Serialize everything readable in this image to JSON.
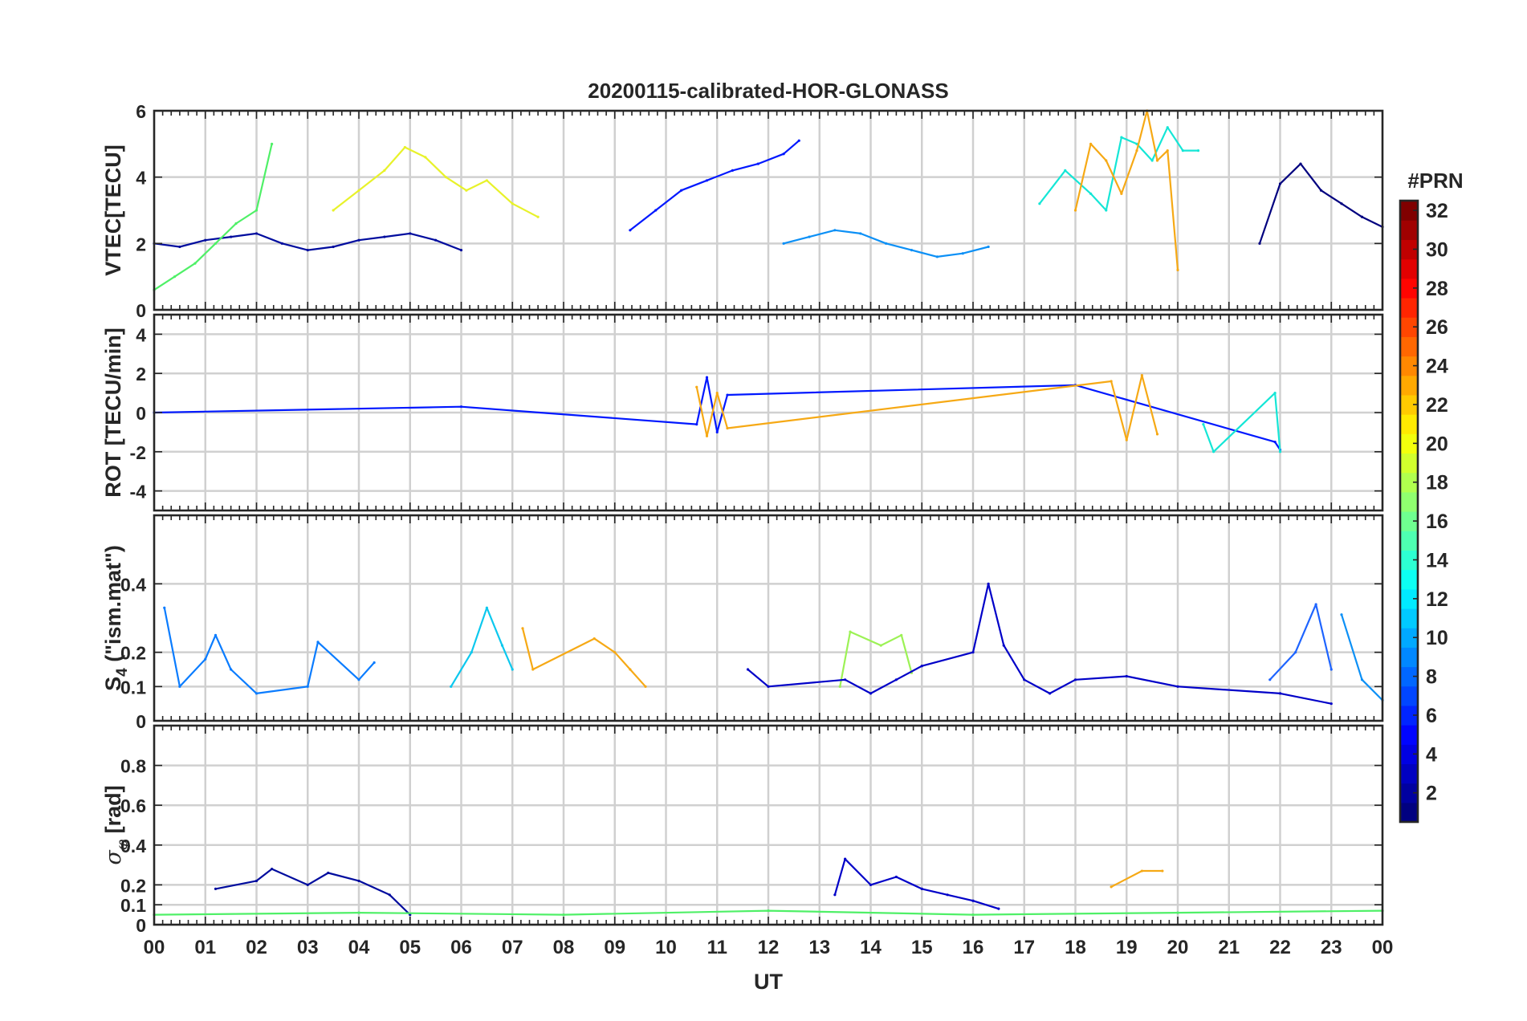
{
  "figure": {
    "title": "20200115-calibrated-HOR-GLONASS",
    "xlabel": "UT",
    "x_ticklabels": [
      "00",
      "01",
      "02",
      "03",
      "04",
      "05",
      "06",
      "07",
      "08",
      "09",
      "10",
      "11",
      "12",
      "13",
      "14",
      "15",
      "16",
      "17",
      "18",
      "19",
      "20",
      "21",
      "22",
      "23",
      "00"
    ]
  },
  "colorbar": {
    "label": "#PRN",
    "ticks": [
      "2",
      "4",
      "6",
      "8",
      "10",
      "12",
      "14",
      "16",
      "18",
      "20",
      "22",
      "24",
      "26",
      "28",
      "30",
      "32"
    ],
    "colormap": "jet",
    "range": [
      1,
      32
    ]
  },
  "chart_data": [
    {
      "type": "line",
      "id": "vtec",
      "ylabel": "VTEC[TECU]",
      "xlim": [
        0,
        24
      ],
      "ylim": [
        0,
        6
      ],
      "yticks": [
        "0",
        "2",
        "4",
        "6"
      ],
      "ytick_values": [
        0,
        2,
        4,
        6
      ],
      "grid": true,
      "colored_by": "PRN",
      "series": [
        {
          "prn": 2,
          "color": "#000c9e",
          "x": [
            0,
            0.5,
            1,
            1.5,
            2,
            2.5,
            3,
            3.5,
            4,
            4.5,
            5,
            5.5,
            6
          ],
          "y": [
            2.0,
            1.9,
            2.1,
            2.2,
            2.3,
            2.0,
            1.8,
            1.9,
            2.1,
            2.2,
            2.3,
            2.1,
            1.8
          ]
        },
        {
          "prn": 4,
          "color": "#0018ff",
          "x": [
            9.3,
            9.8,
            10.3,
            10.8,
            11.3,
            11.8,
            12.3,
            12.6
          ],
          "y": [
            2.4,
            3.0,
            3.6,
            3.9,
            4.2,
            4.4,
            4.7,
            5.1
          ]
        },
        {
          "prn": 10,
          "color": "#0c90f6",
          "x": [
            12.3,
            12.8,
            13.3,
            13.8,
            14.3,
            14.8,
            15.3,
            15.8,
            16.3
          ],
          "y": [
            2.0,
            2.2,
            2.4,
            2.3,
            2.0,
            1.8,
            1.6,
            1.7,
            1.9
          ]
        },
        {
          "prn": 13,
          "color": "#15e6d6",
          "x": [
            17.3,
            17.8,
            18.3,
            18.6,
            18.9,
            19.2,
            19.5,
            19.8,
            20.1,
            20.4
          ],
          "y": [
            3.2,
            4.2,
            3.5,
            3.0,
            5.2,
            5.0,
            4.5,
            5.5,
            4.8,
            4.8
          ]
        },
        {
          "prn": 16,
          "color": "#4ff067",
          "x": [
            0,
            0.4,
            0.8,
            1.2,
            1.6,
            2.0,
            2.3
          ],
          "y": [
            0.6,
            1.0,
            1.4,
            2.0,
            2.6,
            3.0,
            5.0
          ]
        },
        {
          "prn": 19,
          "color": "#e8f22a",
          "x": [
            3.5,
            4.0,
            4.5,
            4.9,
            5.3,
            5.7,
            6.1,
            6.5,
            7.0,
            7.5
          ],
          "y": [
            3.0,
            3.6,
            4.2,
            4.9,
            4.6,
            4.0,
            3.6,
            3.9,
            3.2,
            2.8
          ]
        },
        {
          "prn": 22,
          "color": "#f6a915",
          "x": [
            18.0,
            18.3,
            18.6,
            18.9,
            19.2,
            19.4,
            19.6,
            19.8,
            20.0
          ],
          "y": [
            3.0,
            5.0,
            4.5,
            3.5,
            4.8,
            6.0,
            4.5,
            4.8,
            1.2
          ]
        },
        {
          "prn": 1,
          "color": "#00007f",
          "x": [
            21.6,
            22.0,
            22.4,
            22.8,
            23.2,
            23.6,
            24
          ],
          "y": [
            2.0,
            3.8,
            4.4,
            3.6,
            3.2,
            2.8,
            2.5
          ]
        }
      ]
    },
    {
      "type": "line",
      "id": "rot",
      "ylabel": "ROT [TECU/min]",
      "xlim": [
        0,
        24
      ],
      "ylim": [
        -5,
        5
      ],
      "yticks": [
        "-4",
        "-2",
        "0",
        "2",
        "4"
      ],
      "ytick_values": [
        -4,
        -2,
        0,
        2,
        4
      ],
      "grid": true,
      "colored_by": "PRN",
      "series": [
        {
          "prn": 4,
          "color": "#0018ff",
          "x": [
            0,
            6,
            10.6,
            10.8,
            11,
            11.2,
            18,
            21.9,
            22
          ],
          "y": [
            0,
            0.3,
            -0.6,
            1.8,
            -1.0,
            0.9,
            1.4,
            -1.5,
            -1.9
          ]
        },
        {
          "prn": 22,
          "color": "#f6a915",
          "x": [
            10.6,
            10.8,
            11,
            11.2,
            18.7,
            19.0,
            19.3,
            19.6
          ],
          "y": [
            1.3,
            -1.2,
            1.0,
            -0.8,
            1.6,
            -1.4,
            1.9,
            -1.1
          ]
        },
        {
          "prn": 14,
          "color": "#15e6d6",
          "x": [
            20.5,
            20.7,
            21.9,
            22
          ],
          "y": [
            -0.6,
            -2.0,
            1.0,
            -2.0
          ]
        }
      ]
    },
    {
      "type": "line",
      "id": "s4",
      "ylabel": "S4 (\"ism.mat\")",
      "ylabel_main": "S",
      "ylabel_sub": "4",
      "ylabel_rest": "(\"ism.mat\")",
      "xlim": [
        0,
        24
      ],
      "ylim": [
        0,
        0.6
      ],
      "yticks": [
        "0",
        "0.1",
        "0.2",
        "0.4"
      ],
      "ytick_values": [
        0,
        0.1,
        0.2,
        0.4
      ],
      "grid": true,
      "colored_by": "PRN",
      "series": [
        {
          "prn": 9,
          "color": "#0a7cff",
          "x": [
            0.2,
            0.5,
            1.0,
            1.2,
            1.5,
            2.0,
            3.0,
            3.2,
            4.0,
            4.3
          ],
          "y": [
            0.33,
            0.1,
            0.18,
            0.25,
            0.15,
            0.08,
            0.1,
            0.23,
            0.12,
            0.17
          ]
        },
        {
          "prn": 12,
          "color": "#0cc8ee",
          "x": [
            5.8,
            6.2,
            6.5,
            6.8,
            7.0
          ],
          "y": [
            0.1,
            0.2,
            0.33,
            0.22,
            0.15
          ]
        },
        {
          "prn": 22,
          "color": "#f6a915",
          "x": [
            7.2,
            7.4,
            8.6,
            9.0,
            9.3,
            9.6
          ],
          "y": [
            0.27,
            0.15,
            0.24,
            0.2,
            0.15,
            0.1
          ]
        },
        {
          "prn": 17,
          "color": "#9cf255",
          "x": [
            13.4,
            13.6,
            14.2,
            14.6,
            14.8
          ],
          "y": [
            0.1,
            0.26,
            0.22,
            0.25,
            0.14
          ]
        },
        {
          "prn": 3,
          "color": "#0000c8",
          "x": [
            11.6,
            12.0,
            13.5,
            14.0,
            14.5,
            15.0,
            16.0,
            16.3,
            16.6,
            17.0,
            17.5,
            18.0,
            19.0,
            20.0,
            22.0,
            23.0
          ],
          "y": [
            0.15,
            0.1,
            0.12,
            0.08,
            0.12,
            0.16,
            0.2,
            0.4,
            0.22,
            0.12,
            0.08,
            0.12,
            0.13,
            0.1,
            0.08,
            0.05
          ]
        },
        {
          "prn": 8,
          "color": "#1e64ff",
          "x": [
            21.8,
            22.3,
            22.7,
            23.0
          ],
          "y": [
            0.12,
            0.2,
            0.34,
            0.15
          ]
        },
        {
          "prn": 10,
          "color": "#0c90f6",
          "x": [
            23.2,
            23.6,
            24
          ],
          "y": [
            0.31,
            0.12,
            0.06
          ]
        }
      ]
    },
    {
      "type": "line",
      "id": "sigma_phi",
      "ylabel": "σφ[rad]",
      "ylabel_main": "σ",
      "ylabel_sub": "φ",
      "ylabel_rest": "[rad]",
      "xlim": [
        0,
        24
      ],
      "ylim": [
        0,
        1
      ],
      "yticks": [
        "0",
        "0.1",
        "0.2",
        "0.4",
        "0.6",
        "0.8"
      ],
      "ytick_values": [
        0,
        0.1,
        0.2,
        0.4,
        0.6,
        0.8
      ],
      "grid": true,
      "colored_by": "PRN",
      "series": [
        {
          "prn": 2,
          "color": "#000c9e",
          "x": [
            1.2,
            2.0,
            2.3,
            3.0,
            3.4,
            4.0,
            4.6,
            5.0
          ],
          "y": [
            0.18,
            0.22,
            0.28,
            0.2,
            0.26,
            0.22,
            0.15,
            0.05
          ]
        },
        {
          "prn": 3,
          "color": "#0000c8",
          "x": [
            13.3,
            13.5,
            14.0,
            14.5,
            15.0,
            15.5,
            16.0,
            16.5
          ],
          "y": [
            0.15,
            0.33,
            0.2,
            0.24,
            0.18,
            0.15,
            0.12,
            0.08
          ]
        },
        {
          "prn": 22,
          "color": "#f6a915",
          "x": [
            18.7,
            19.3,
            19.7
          ],
          "y": [
            0.19,
            0.27,
            0.27
          ]
        },
        {
          "prn": 16,
          "color": "#4ff067",
          "x": [
            0,
            4,
            8,
            12,
            16,
            20,
            24
          ],
          "y": [
            0.05,
            0.06,
            0.05,
            0.07,
            0.05,
            0.06,
            0.07
          ]
        }
      ]
    }
  ]
}
